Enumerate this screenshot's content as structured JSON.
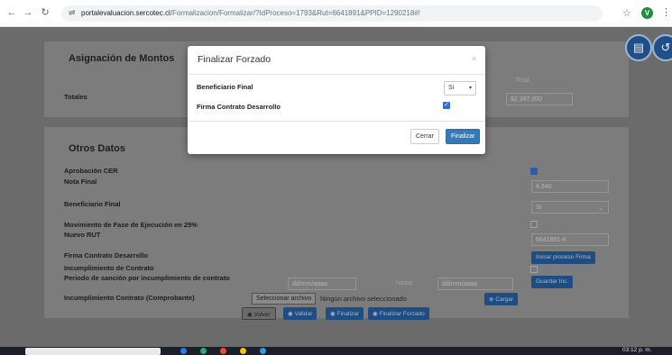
{
  "browser": {
    "url_host": "portalevaluacion.sercotec.cl",
    "url_path": "/Formalizacion/Formalizar/?IdProceso=1793&Rut=6641891&PPID=1290218#!",
    "profile_initial": "V"
  },
  "section1": {
    "title": "Asignación de Montos",
    "totals_label": "Totales",
    "total_header": "Total",
    "total_value": "$2.397.000"
  },
  "section2": {
    "title": "Otros Datos",
    "labels": {
      "aprobacion_cer": "Aprobación CER",
      "nota_final": "Nota Final",
      "beneficiario_final": "Beneficiario Final",
      "movimiento": "Movimiento de Fase de Ejecución en 25%",
      "nuevo_rut": "Nuevo RUT",
      "firma": "Firma Contrato Desarrollo",
      "incumplimiento": "Incumplimiento de Contrato",
      "periodo": "Periodo de sanción por incumplimiento de contrato",
      "comprobante": "Incumplimiento Contrato (Comprobante)"
    },
    "nota_final_value": "4,840",
    "beneficiario_value": "Si",
    "nuevo_rut_value": "6641891-K",
    "iniciar_firma_label": "Iniciar proceso Firma",
    "date_from_placeholder": "dd/mm/aaaa",
    "date_to_placeholder": "dd/mm/aaaa",
    "hasta_label": "hasta",
    "guardar_inc_label": "Guardar Inc.",
    "file_button_label": "Seleccionar archivo",
    "file_status": "Ningún archivo seleccionado",
    "cargar_label": "Cargar",
    "aprobacion_checked": true,
    "movimiento_checked": false,
    "incumplimiento_checked": false
  },
  "actions": {
    "volver": "Volver",
    "validar": "Validar",
    "finalizar": "Finalizar",
    "finalizar_forzado": "Finalizar Forzado"
  },
  "modal": {
    "title": "Finalizar Forzado",
    "close": "×",
    "beneficiario_label": "Beneficiario Final",
    "beneficiario_value": "Si",
    "firma_label": "Firma Contrato Desarrollo",
    "firma_checked": true,
    "cancel_label": "Cerrar",
    "confirm_label": "Finalizar"
  },
  "taskbar": {
    "time": "03:12 p. m."
  },
  "colors": {
    "primary": "#337ab7",
    "checkbox": "#2b6fd6",
    "overlay": "#6b6b6b"
  }
}
